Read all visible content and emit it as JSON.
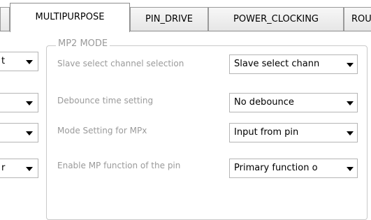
{
  "tabs": [
    {
      "label": "MULTIPURPOSE",
      "active": true
    },
    {
      "label": "PIN_DRIVE",
      "active": false
    },
    {
      "label": "POWER_CLOCKING",
      "active": false
    },
    {
      "label": "ROU",
      "active": false
    }
  ],
  "left_column": {
    "values": [
      "t",
      "",
      "",
      "r"
    ]
  },
  "group": {
    "title": "MP2 MODE",
    "fields": [
      {
        "label": "Slave select channel selection",
        "value": "Slave select chann"
      },
      {
        "label": "Debounce time setting",
        "value": "No debounce"
      },
      {
        "label": "Mode Setting for MPx",
        "value": "Input from pin"
      },
      {
        "label": "Enable MP function of the pin",
        "value": "Primary function o"
      }
    ]
  },
  "icons": {
    "dropdown": "chevron-down-icon"
  }
}
